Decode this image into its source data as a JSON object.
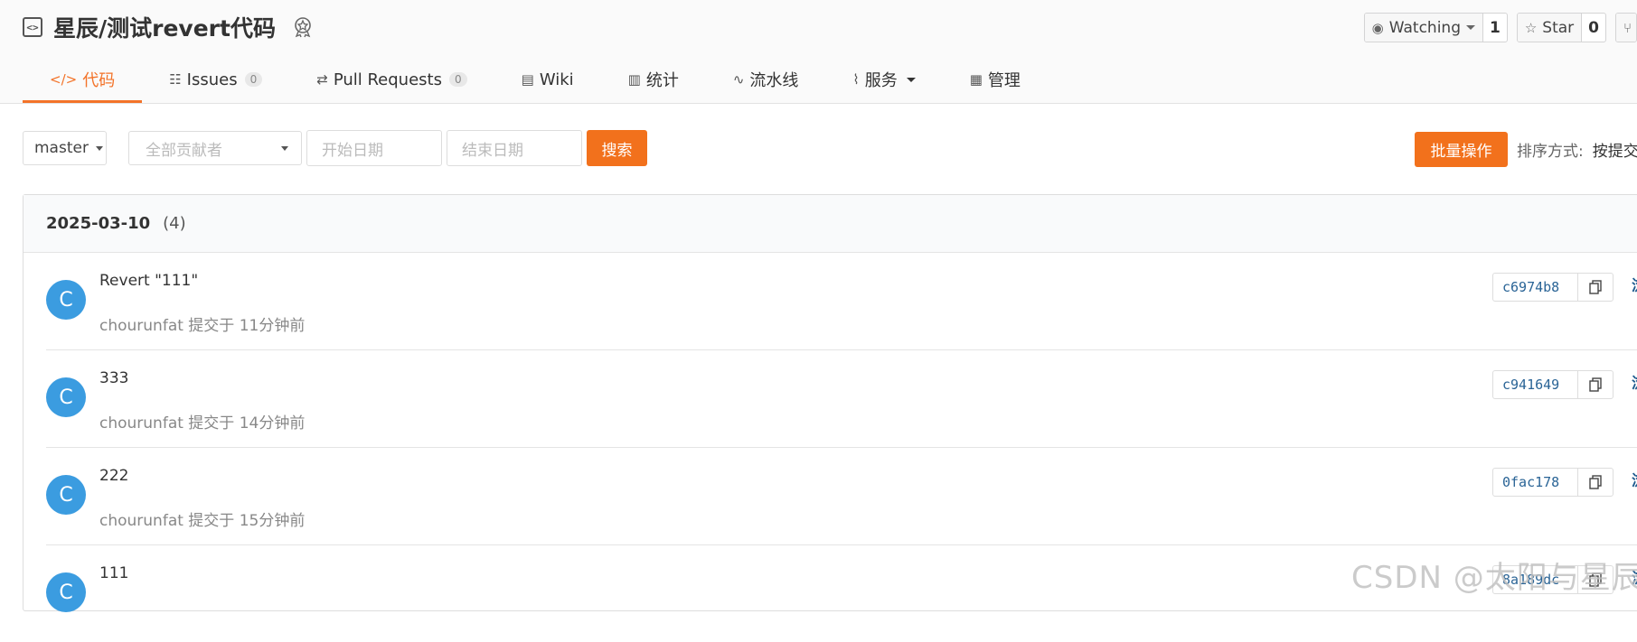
{
  "repo": {
    "title": "星辰/测试revert代码"
  },
  "header_buttons": {
    "watching_label": "Watching",
    "watching_count": "1",
    "star_label": "Star",
    "star_count": "0"
  },
  "tabs": [
    {
      "label": "代码",
      "icon": "code-icon",
      "active": true
    },
    {
      "label": "Issues",
      "icon": "issues-icon",
      "count": "0"
    },
    {
      "label": "Pull Requests",
      "icon": "pull-request-icon",
      "count": "0"
    },
    {
      "label": "Wiki",
      "icon": "book-icon"
    },
    {
      "label": "统计",
      "icon": "bar-chart-icon"
    },
    {
      "label": "流水线",
      "icon": "pipeline-icon"
    },
    {
      "label": "服务",
      "icon": "pulse-icon"
    },
    {
      "label": "管理",
      "icon": "settings-doc-icon"
    }
  ],
  "filters": {
    "branch": "master",
    "contributor_placeholder": "全部贡献者",
    "start_date_placeholder": "开始日期",
    "end_date_placeholder": "结束日期",
    "search_label": "搜索",
    "batch_label": "批量操作",
    "sort_label": "排序方式:",
    "sort_value": "按提交"
  },
  "commit_group": {
    "date": "2025-03-10",
    "count": "(4)"
  },
  "commits": [
    {
      "avatar": "C",
      "message": "Revert \"111\"",
      "meta": "chourunfat 提交于 11分钟前",
      "sha": "c6974b8",
      "browse": "浏览"
    },
    {
      "avatar": "C",
      "message": "333",
      "meta": "chourunfat 提交于 14分钟前",
      "sha": "c941649",
      "browse": "浏览"
    },
    {
      "avatar": "C",
      "message": "222",
      "meta": "chourunfat 提交于 15分钟前",
      "sha": "0fac178",
      "browse": "浏览"
    },
    {
      "avatar": "C",
      "message": "111",
      "meta": "",
      "sha": "8a189dc",
      "browse": "浏览"
    }
  ],
  "watermark": "CSDN @太阳与星辰",
  "colors": {
    "accent": "#f2711c",
    "avatar": "#3b9ce0",
    "link": "#1f5b8f"
  }
}
